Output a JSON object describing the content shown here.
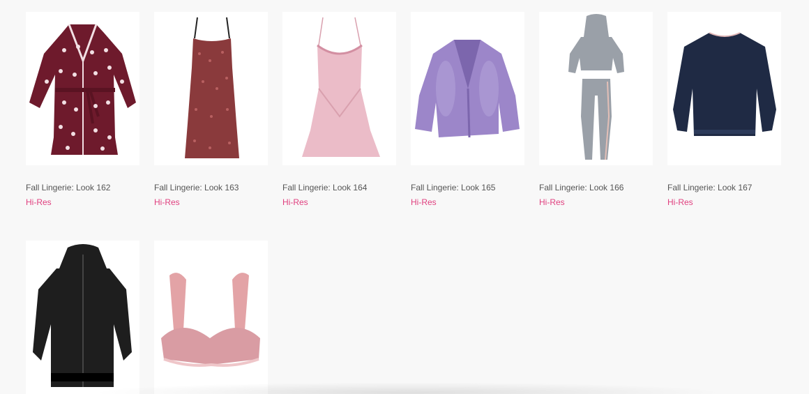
{
  "products": [
    {
      "caption": "Fall Lingerie: Look 162",
      "link": "Hi-Res",
      "icon": "robe-icon",
      "color": "#6e1a2c"
    },
    {
      "caption": "Fall Lingerie: Look 163",
      "link": "Hi-Res",
      "icon": "slip-dress-icon",
      "color": "#8a3a3c"
    },
    {
      "caption": "Fall Lingerie: Look 164",
      "link": "Hi-Res",
      "icon": "chemise-icon",
      "color": "#e9b7c3"
    },
    {
      "caption": "Fall Lingerie: Look 165",
      "link": "Hi-Res",
      "icon": "fur-jacket-icon",
      "color": "#9c86c9"
    },
    {
      "caption": "Fall Lingerie: Look 166",
      "link": "Hi-Res",
      "icon": "lounge-set-icon",
      "color": "#9aa0a8"
    },
    {
      "caption": "Fall Lingerie: Look 167",
      "link": "Hi-Res",
      "icon": "sweater-icon",
      "color": "#1f2a44"
    },
    {
      "caption": "",
      "link": "",
      "icon": "hooded-jacket-icon",
      "color": "#1e1e1e"
    },
    {
      "caption": "",
      "link": "",
      "icon": "bra-icon",
      "color": "#e1a2a8"
    }
  ],
  "colors": {
    "accent": "#e0407f",
    "caption": "#555555",
    "background": "#f8f8f8"
  }
}
